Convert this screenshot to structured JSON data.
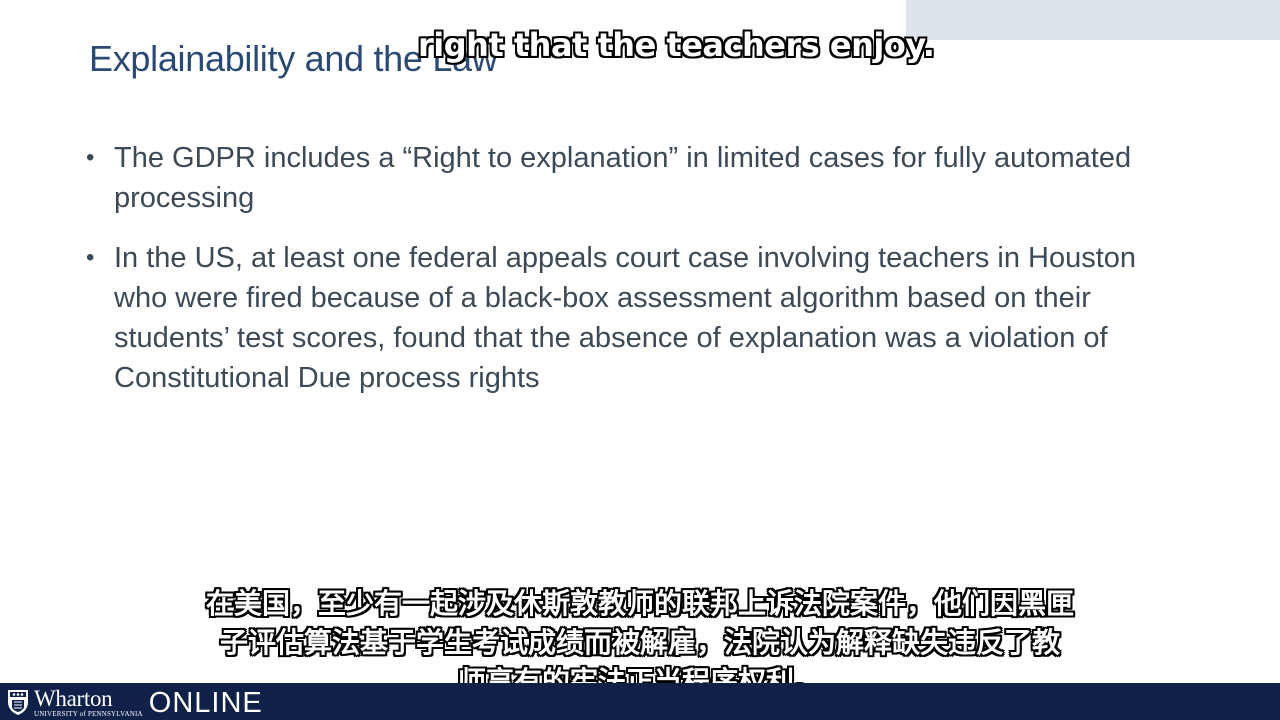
{
  "slide": {
    "title": "Explainability and the Law",
    "bullets": [
      "The GDPR includes a “Right to explanation” in limited cases for fully automated processing",
      "In the US, at least one federal appeals court case involving teachers in Houston who were fired because of a black-box assessment algorithm based on their students’ test scores, found that the absence of explanation was a violation of Constitutional Due process rights"
    ],
    "bullet_marker": "•"
  },
  "subtitles": {
    "english": "right that the teachers enjoy.",
    "chinese": [
      "在美国，至少有一起涉及休斯敦教师的联邦上诉法院案件，他们因黑匣",
      "子评估算法基于学生考试成绩而被解雇，法院认为解释缺失违反了教",
      "师享有的宪法正当程序权利。"
    ]
  },
  "footer": {
    "logo_name": "Wharton",
    "logo_sub": "UNIVERSITY of PENNSYLVANIA",
    "brand_suffix": "ONLINE",
    "shield_icon": "penn-shield-icon"
  },
  "colors": {
    "title": "#2b4a73",
    "body_text": "#3c4a57",
    "footer_bg": "#0f2149",
    "top_bar": "#dde3ea"
  }
}
